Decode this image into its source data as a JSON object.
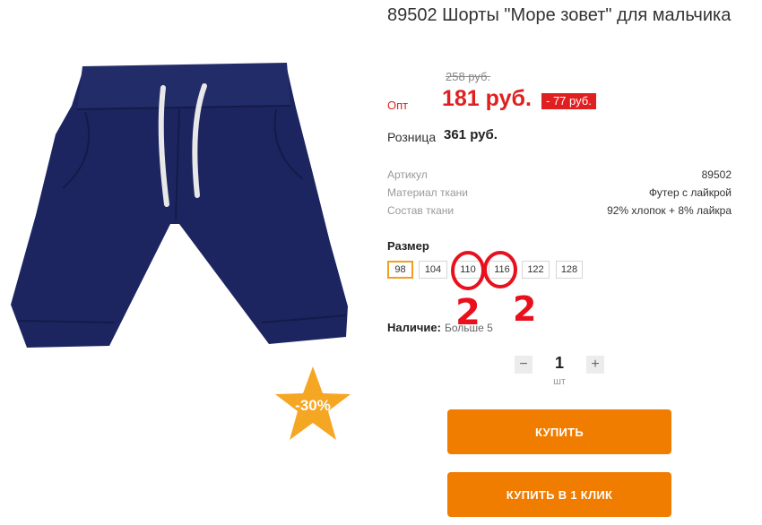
{
  "product": {
    "title": "89502 Шорты \"Море зовет\" для мальчика",
    "discount_badge": "-30%",
    "colors": {
      "accent": "#f07c00",
      "price_red": "#e02020",
      "shorts_navy": "#1c2560"
    }
  },
  "pricing": {
    "old_price": "258 руб.",
    "opt_label": "Опт",
    "opt_price": "181 руб.",
    "discount_tag": "- 77 руб.",
    "retail_label": "Розница",
    "retail_price": "361 руб."
  },
  "attributes": [
    {
      "label": "Артикул",
      "value": "89502"
    },
    {
      "label": "Материал ткани",
      "value": "Футер с лайкрой"
    },
    {
      "label": "Состав ткани",
      "value": "92% хлопок + 8% лайкра"
    }
  ],
  "sizes": {
    "title": "Размер",
    "options": [
      "98",
      "104",
      "110",
      "116",
      "122",
      "128"
    ],
    "selected": "98"
  },
  "annotations": {
    "mark_left": "2",
    "mark_right": "2"
  },
  "availability": {
    "label": "Наличие:",
    "value": "Больше 5"
  },
  "quantity": {
    "value": "1",
    "unit": "шт",
    "minus_icon": "minus-icon",
    "plus_icon": "plus-icon"
  },
  "actions": {
    "buy_label": "КУПИТЬ",
    "buy_one_click_label": "КУПИТЬ В 1 КЛИК"
  }
}
